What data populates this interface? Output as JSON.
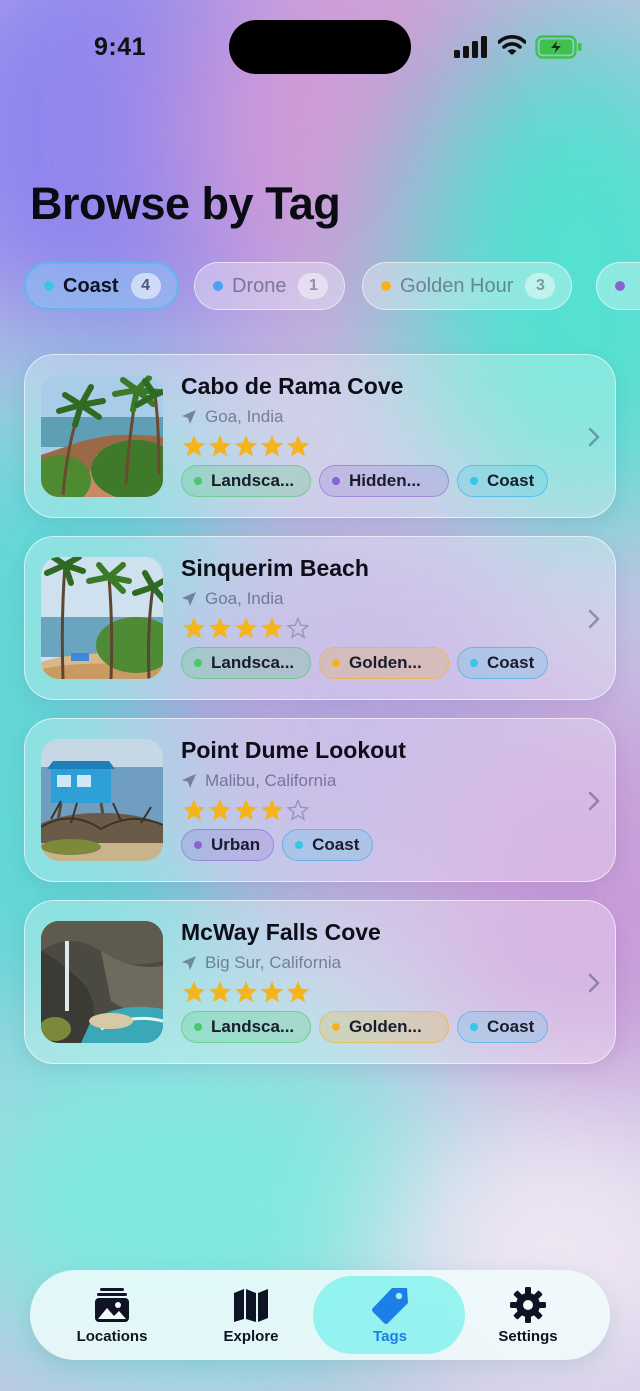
{
  "status_bar": {
    "time": "9:41",
    "icons": [
      "cellular-signal-icon",
      "wifi-icon",
      "battery-charging-icon"
    ]
  },
  "page": {
    "title": "Browse by Tag"
  },
  "tag_filters": [
    {
      "label": "Coast",
      "count": "4",
      "color": "#36c6e8",
      "selected": true
    },
    {
      "label": "Drone",
      "count": "1",
      "color": "#4aa3f0",
      "selected": false
    },
    {
      "label": "Golden Hour",
      "count": "3",
      "color": "#f5b21e",
      "selected": false
    },
    {
      "label": "",
      "count": "",
      "color": "#8a63d2",
      "selected": false
    }
  ],
  "locations": [
    {
      "name": "Cabo de Rama Cove",
      "location": "Goa, India",
      "rating": 5,
      "max_rating": 5,
      "tags": [
        {
          "label": "Landsca...",
          "color": "#4cc76a"
        },
        {
          "label": "Hidden...",
          "color": "#8a63d2"
        },
        {
          "label": "Coast",
          "color": "#36c6e8"
        }
      ]
    },
    {
      "name": "Sinquerim Beach",
      "location": "Goa, India",
      "rating": 4,
      "max_rating": 5,
      "tags": [
        {
          "label": "Landsca...",
          "color": "#4cc76a"
        },
        {
          "label": "Golden...",
          "color": "#f5b21e"
        },
        {
          "label": "Coast",
          "color": "#36c6e8"
        }
      ]
    },
    {
      "name": "Point Dume Lookout",
      "location": "Malibu, California",
      "rating": 4,
      "max_rating": 5,
      "tags": [
        {
          "label": "Urban",
          "color": "#8a63d2"
        },
        {
          "label": "Coast",
          "color": "#36c6e8"
        }
      ]
    },
    {
      "name": "McWay Falls Cove",
      "location": "Big Sur, California",
      "rating": 5,
      "max_rating": 5,
      "tags": [
        {
          "label": "Landsca...",
          "color": "#4cc76a"
        },
        {
          "label": "Golden...",
          "color": "#f5b21e"
        },
        {
          "label": "Coast",
          "color": "#36c6e8"
        }
      ]
    }
  ],
  "tab_bar": {
    "tabs": [
      {
        "label": "Locations",
        "icon": "photo-stack-icon",
        "active": false
      },
      {
        "label": "Explore",
        "icon": "map-icon",
        "active": false
      },
      {
        "label": "Tags",
        "icon": "tag-icon",
        "active": true
      },
      {
        "label": "Settings",
        "icon": "gear-icon",
        "active": false
      }
    ]
  },
  "colors": {
    "accent": "#1b7fe6",
    "star": "#f6b41c",
    "selected_chip_border": "#5fb6f0"
  }
}
